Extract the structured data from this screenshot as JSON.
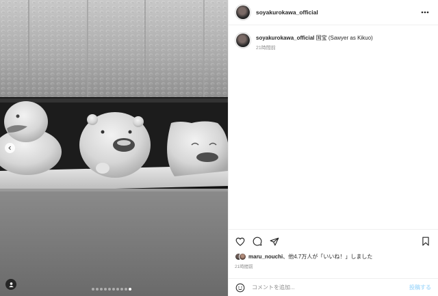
{
  "media": {
    "carousel_dots": 10,
    "active_dot": 9,
    "icons": {
      "prev": "chevron-left-icon",
      "tag": "user-tag-icon"
    }
  },
  "post": {
    "username": "soyakurokawa_official",
    "more_icon": "more-horizontal-icon",
    "caption": {
      "user": "soyakurokawa_official",
      "text": "国宝 (Sawyer as Kikuo)",
      "time": "21時間前"
    },
    "actions": {
      "like_icon": "heart-icon",
      "comment_icon": "comment-icon",
      "share_icon": "send-icon",
      "save_icon": "bookmark-icon"
    },
    "likes": {
      "user": "maru_nouchi",
      "text": "、他4.7万人が「いいね！」しました"
    },
    "time": "21時間前",
    "comment": {
      "emoji_icon": "smile-icon",
      "placeholder": "コメントを追加...",
      "post_label": "投稿する"
    }
  }
}
